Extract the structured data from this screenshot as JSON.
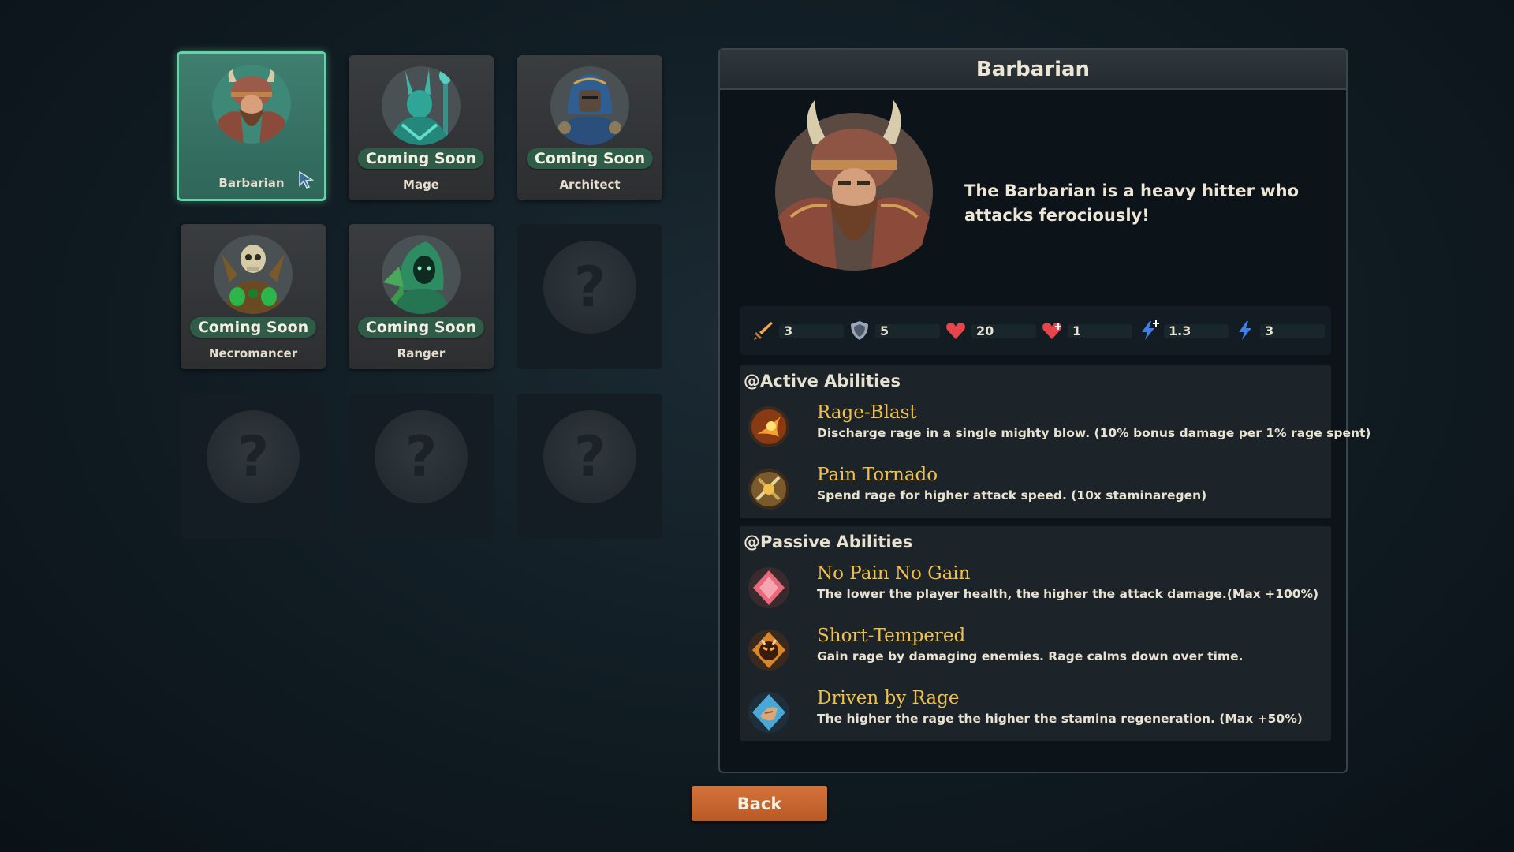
{
  "classes": [
    {
      "name": "Barbarian",
      "status": "",
      "selected": true,
      "portrait": "barbarian-portrait"
    },
    {
      "name": "Mage",
      "status": "Coming Soon",
      "selected": false,
      "portrait": "mage-portrait"
    },
    {
      "name": "Architect",
      "status": "Coming Soon",
      "selected": false,
      "portrait": "architect-portrait"
    },
    {
      "name": "Necromancer",
      "status": "Coming Soon",
      "selected": false,
      "portrait": "necromancer-portrait"
    },
    {
      "name": "Ranger",
      "status": "Coming Soon",
      "selected": false,
      "portrait": "ranger-portrait"
    }
  ],
  "locked_slot_symbol": "?",
  "detail": {
    "title": "Barbarian",
    "description": "The Barbarian is a heavy hitter who attacks ferociously!",
    "stats": [
      {
        "icon": "sword-icon",
        "value": "3"
      },
      {
        "icon": "shield-icon",
        "value": "5"
      },
      {
        "icon": "heart-icon",
        "value": "20"
      },
      {
        "icon": "heart-regen-icon",
        "value": "1"
      },
      {
        "icon": "stamina-regen-icon",
        "value": "1.3"
      },
      {
        "icon": "lightning-icon",
        "value": "3"
      }
    ],
    "active_title": "@Active Abilities",
    "active": [
      {
        "name": "Rage-Blast",
        "desc": "Discharge rage in a single mighty blow. (10% bonus damage per 1% rage spent)",
        "icon": "rage-blast-icon"
      },
      {
        "name": "Pain Tornado",
        "desc": "Spend rage for higher attack speed. (10x staminaregen)",
        "icon": "pain-tornado-icon"
      }
    ],
    "passive_title": "@Passive Abilities",
    "passive": [
      {
        "name": "No Pain No Gain",
        "desc": "The lower the player health, the higher the attack damage.(Max +100%)",
        "icon": "no-pain-no-gain-icon"
      },
      {
        "name": "Short-Tempered",
        "desc": "Gain rage by damaging enemies. Rage calms down over time.",
        "icon": "short-tempered-icon"
      },
      {
        "name": "Driven by Rage",
        "desc": "The higher the rage the higher the stamina regeneration. (Max +50%)",
        "icon": "driven-by-rage-icon"
      }
    ]
  },
  "back_label": "Back",
  "colors": {
    "selected_border": "#5fd6a6",
    "ability_name": "#f0c04a",
    "back_button": "#c86530"
  }
}
